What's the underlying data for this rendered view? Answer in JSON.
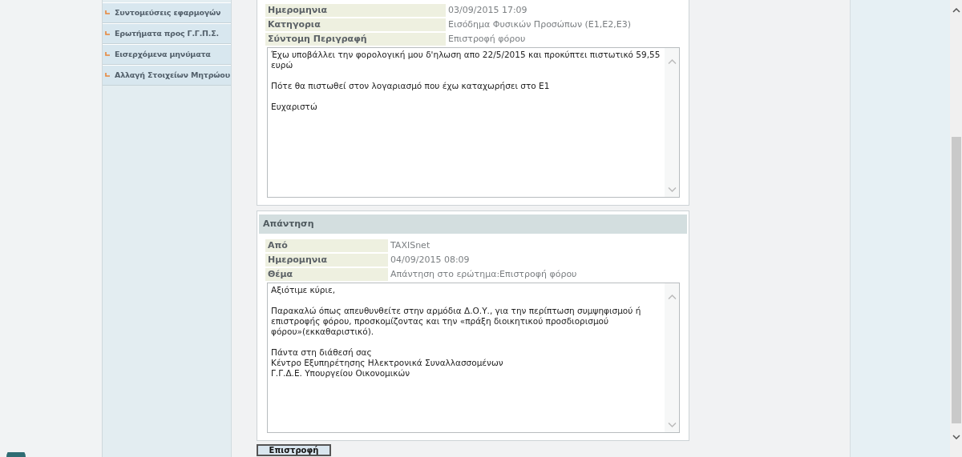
{
  "sidebar": {
    "items": [
      {
        "label": "Συντομεύσεις εφαρμογών"
      },
      {
        "label": "Ερωτήματα προς Γ.Γ.Π.Σ."
      },
      {
        "label": "Εισερχόμενα μηνύματα"
      },
      {
        "label": "Αλλαγή Στοιχείων Μητρώου"
      }
    ]
  },
  "question": {
    "fields": [
      {
        "label": "Ημερομηνια",
        "value": "03/09/2015 17:09"
      },
      {
        "label": "Κατηγορια",
        "value": "Εισόδημα Φυσικών Προσώπων (Ε1,Ε2,Ε3)"
      },
      {
        "label": "Σύντομη Περιγραφή",
        "value": "Επιστροφή φόρου"
      }
    ],
    "message": "Έχω υποβάλλει την φορολογική μου δ'ηλωση απο 22/5/2015 και προκύπτει πιστωτικό 59,55 ευρώ\n\nΠότε θα πιστωθεί στον λογαριασμό που έχω καταχωρήσει στο Ε1\n\nΕυχαριστώ"
  },
  "answer": {
    "title": "Απάντηση",
    "fields": [
      {
        "label": "Από",
        "value": "TAXISnet"
      },
      {
        "label": "Ημερομηνια",
        "value": "04/09/2015 08:09"
      },
      {
        "label": "Θέμα",
        "value": "Απάντηση στο ερώτημα:Επιστροφή φόρου"
      }
    ],
    "message": "Αξιότιμε κύριε,\n\nΠαρακαλώ όπως απευθυνθείτε στην αρμόδια Δ.Ο.Υ., για την περίπτωση συμψηφισμού ή επιστροφής φόρου, προσκομίζοντας και την «πράξη διοικητικού προσδιορισμού φόρου»(εκκαθαριστικό).\n\nΠάντα στη διάθεσή σας\nΚέντρο Εξυπηρέτησης Ηλεκτρονικά Συναλλασσομένων\nΓ.Γ.Δ.Ε. Υπουργείου Οικονομικών"
  },
  "back_button": "Επιστροφή"
}
